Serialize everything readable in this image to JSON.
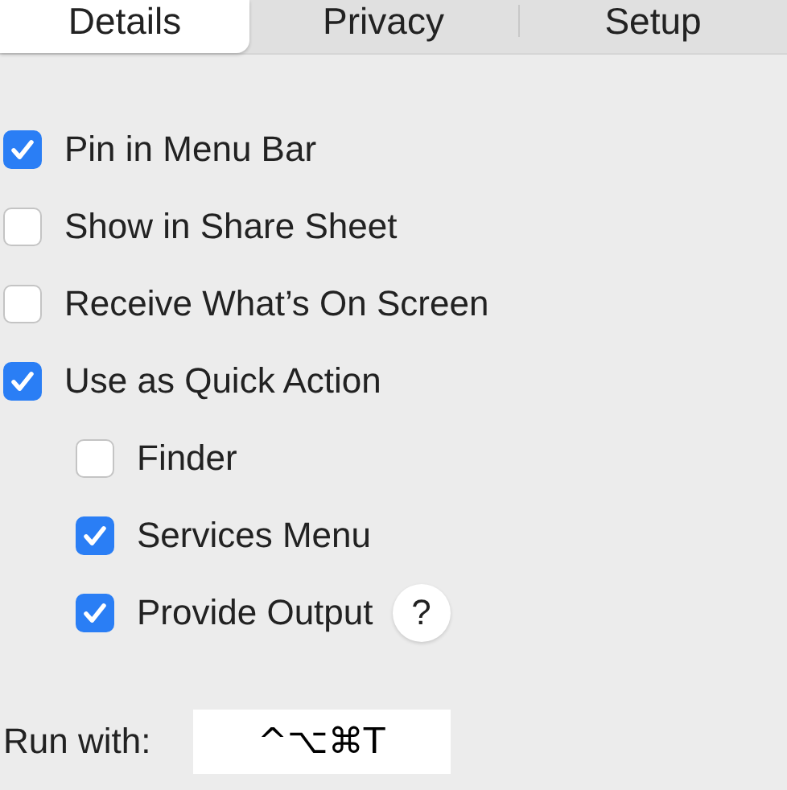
{
  "tabs": [
    {
      "label": "Details",
      "selected": true
    },
    {
      "label": "Privacy",
      "selected": false
    },
    {
      "label": "Setup",
      "selected": false
    }
  ],
  "options": [
    {
      "label": "Pin in Menu Bar",
      "checked": true
    },
    {
      "label": "Show in Share Sheet",
      "checked": false
    },
    {
      "label": "Receive What’s On Screen",
      "checked": false
    },
    {
      "label": "Use as Quick Action",
      "checked": true,
      "children": [
        {
          "label": "Finder",
          "checked": false
        },
        {
          "label": "Services Menu",
          "checked": true
        },
        {
          "label": "Provide Output",
          "checked": true,
          "help": "?"
        }
      ]
    }
  ],
  "run_with": {
    "label": "Run with:",
    "value": "^⌥⌘T"
  }
}
